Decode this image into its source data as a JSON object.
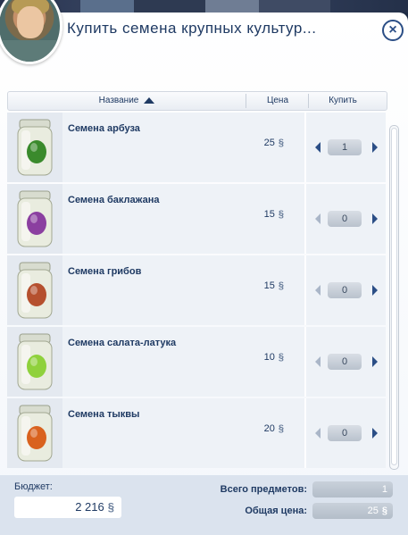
{
  "dialog": {
    "title": "Купить семена крупных культур...",
    "close_label": "×"
  },
  "icons": {
    "close": "close-icon",
    "sort": "sort-ascending-icon",
    "currency": "simoleon-icon",
    "decrease": "arrow-left-icon",
    "increase": "arrow-right-icon"
  },
  "table": {
    "headers": {
      "name": "Название",
      "price": "Цена",
      "buy": "Купить"
    },
    "rows": [
      {
        "name": "Семена арбуза",
        "price": "25",
        "quantity": "1",
        "seed_color": "#3a8a2c"
      },
      {
        "name": "Семена баклажана",
        "price": "15",
        "quantity": "0",
        "seed_color": "#8b3fa0"
      },
      {
        "name": "Семена грибов",
        "price": "15",
        "quantity": "0",
        "seed_color": "#b5502e"
      },
      {
        "name": "Семена салата-латука",
        "price": "10",
        "quantity": "0",
        "seed_color": "#8fd13c"
      },
      {
        "name": "Семена тыквы",
        "price": "20",
        "quantity": "0",
        "seed_color": "#d9621e"
      }
    ]
  },
  "footer": {
    "budget_label": "Бюджет:",
    "budget_value": "2 216",
    "total_items_label": "Всего предметов:",
    "total_items_value": "1",
    "total_price_label": "Общая цена:",
    "total_price_value": "25"
  },
  "colors": {
    "accent": "#1f3a63",
    "arrow": "#2b4e86"
  }
}
